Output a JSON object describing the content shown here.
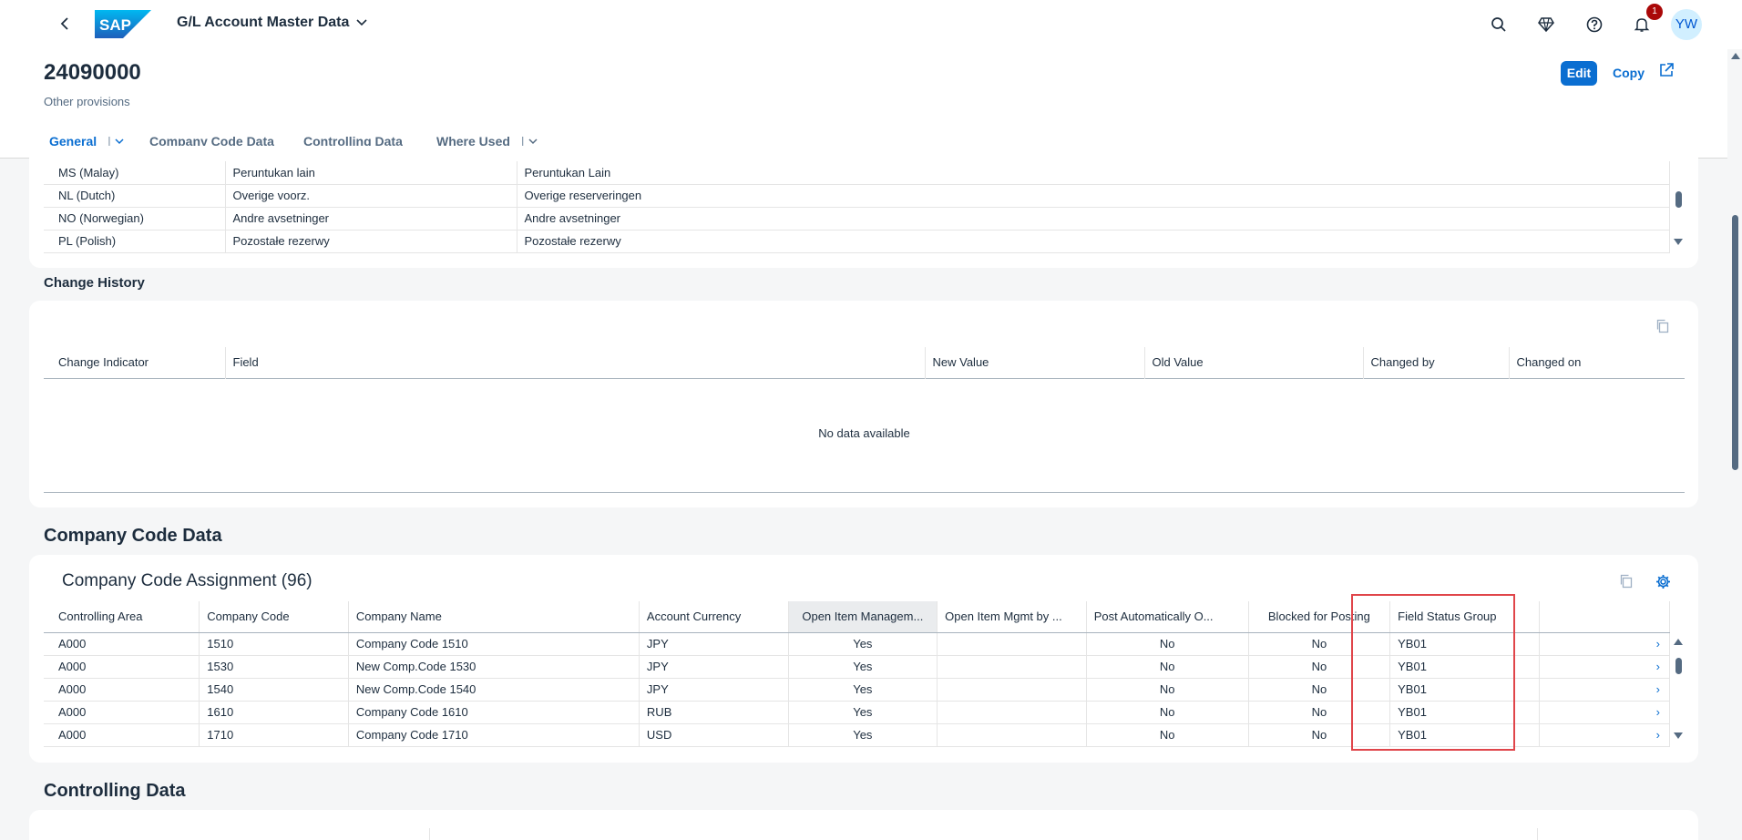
{
  "shell": {
    "logo_text": "SAP",
    "app_title": "G/L Account Master Data",
    "notification_count": "1",
    "avatar_initials": "YW",
    "icons": [
      "back-icon",
      "search-icon",
      "diamond-icon",
      "help-icon",
      "bell-icon",
      "chevron-down-icon"
    ]
  },
  "object": {
    "id": "24090000",
    "description": "Other provisions",
    "actions": {
      "edit": "Edit",
      "copy": "Copy"
    }
  },
  "tabs": [
    {
      "label": "General",
      "has_menu": true
    },
    {
      "label": "Company Code Data"
    },
    {
      "label": "Controlling Data"
    },
    {
      "label": "Where Used",
      "has_menu": true
    }
  ],
  "translations": {
    "rows": [
      [
        "MS (Malay)",
        "Peruntukan lain",
        "Peruntukan Lain"
      ],
      [
        "NL (Dutch)",
        "Overige voorz.",
        "Overige reserveringen"
      ],
      [
        "NO (Norwegian)",
        "Andre avsetninger",
        "Andre avsetninger"
      ],
      [
        "PL (Polish)",
        "Pozostałe rezerwy",
        "Pozostałe rezerwy"
      ]
    ]
  },
  "change_history": {
    "title": "Change History",
    "columns": [
      "Change Indicator",
      "Field",
      "New Value",
      "Old Value",
      "Changed by",
      "Changed on"
    ],
    "empty_text": "No data available"
  },
  "company_code_section": {
    "title": "Company Code Data",
    "table_title": "Company Code Assignment (96)",
    "columns": [
      "Controlling Area",
      "Company Code",
      "Company Name",
      "Account Currency",
      "Open Item Managem...",
      "Open Item Mgmt by ...",
      "Post Automatically O...",
      "Blocked for Posting",
      "Field Status Group"
    ],
    "rows": [
      [
        "A000",
        "1510",
        "Company Code 1510",
        "JPY",
        "Yes",
        "",
        "No",
        "No",
        "YB01"
      ],
      [
        "A000",
        "1530",
        "New Comp.Code 1530",
        "JPY",
        "Yes",
        "",
        "No",
        "No",
        "YB01"
      ],
      [
        "A000",
        "1540",
        "New Comp.Code 1540",
        "JPY",
        "Yes",
        "",
        "No",
        "No",
        "YB01"
      ],
      [
        "A000",
        "1610",
        "Company Code 1610",
        "RUB",
        "Yes",
        "",
        "No",
        "No",
        "YB01"
      ],
      [
        "A000",
        "1710",
        "Company Code 1710",
        "USD",
        "Yes",
        "",
        "No",
        "No",
        "YB01"
      ]
    ]
  },
  "controlling_section": {
    "title": "Controlling Data"
  },
  "colors": {
    "accent": "#0a6ed1",
    "highlight_box": "#e0454a",
    "badge": "#aa0808"
  }
}
